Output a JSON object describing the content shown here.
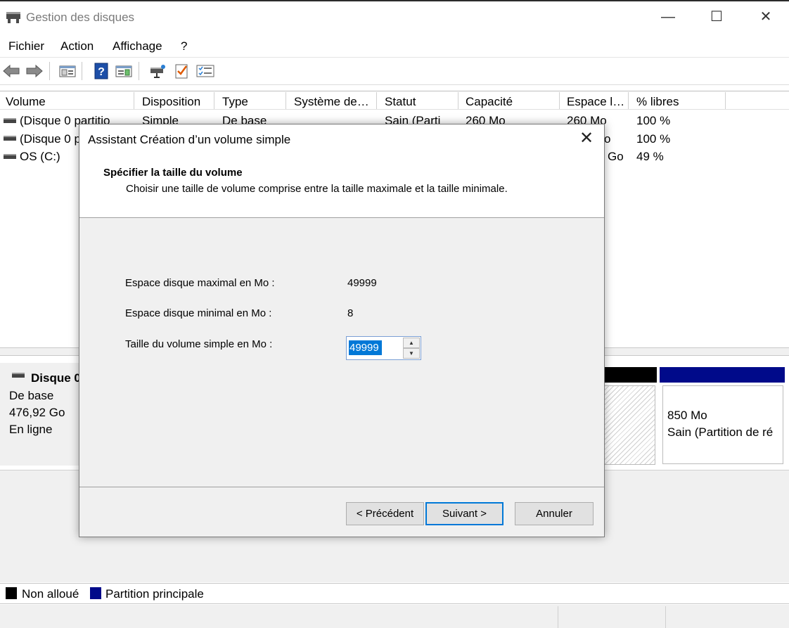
{
  "window": {
    "title": "Gestion des disques",
    "minimize": "—",
    "maximize": "☐",
    "close": "✕"
  },
  "menu": [
    "Fichier",
    "Action",
    "Affichage",
    "?"
  ],
  "toolbar": {
    "icons": [
      "back-arrow-icon",
      "forward-arrow-icon",
      "console-tree-icon",
      "help-icon",
      "action-pane-icon",
      "connect-disk-icon",
      "checklist-icon",
      "properties-icon"
    ]
  },
  "volume_list": {
    "columns": [
      "Volume",
      "Disposition",
      "Type",
      "Système de…",
      "Statut",
      "Capacité",
      "Espace l…",
      "% libres"
    ],
    "rows": [
      {
        "volume": "(Disque 0 partitio",
        "disposition": "Simple",
        "type": "De base",
        "statut": "Sain (Parti",
        "capacite": "260 Mo",
        "espace": "260 Mo",
        "libres": "100 %"
      },
      {
        "volume": "(Disque 0 p",
        "espace": "o",
        "libres": "100 %"
      },
      {
        "volume": "OS (C:)",
        "espace": "Go",
        "libres": "49 %"
      }
    ]
  },
  "disk": {
    "name": "Disque 0",
    "type": "De base",
    "size": "476,92 Go",
    "status": "En ligne",
    "partition_size": "850 Mo",
    "partition_status": "Sain (Partition de ré"
  },
  "legend": {
    "unallocated": "Non alloué",
    "primary": "Partition principale",
    "colors": {
      "unallocated": "#000000",
      "primary": "#000a8a"
    }
  },
  "dialog": {
    "title": "Assistant Création d’un volume simple",
    "close": "✕",
    "heading": "Spécifier la taille du volume",
    "subheading": "Choisir une taille de volume comprise entre la taille maximale et la taille minimale.",
    "max_label": "Espace disque maximal en Mo :",
    "max_value": "49999",
    "min_label": "Espace disque minimal en Mo :",
    "min_value": "8",
    "size_label": "Taille du volume simple en Mo :",
    "size_value": "49999",
    "buttons": {
      "back": "< Précédent",
      "next": "Suivant >",
      "cancel": "Annuler"
    }
  }
}
